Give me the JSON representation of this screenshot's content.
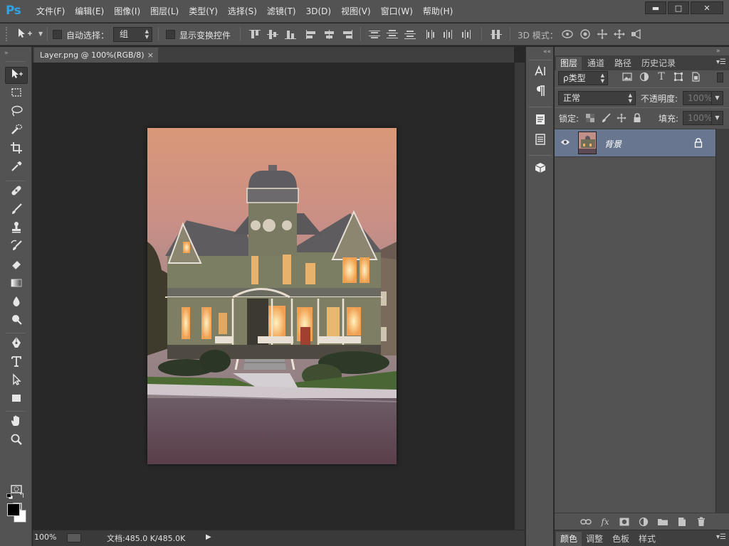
{
  "app": {
    "logo": "Ps"
  },
  "menu": {
    "items": [
      "文件(F)",
      "编辑(E)",
      "图像(I)",
      "图层(L)",
      "类型(Y)",
      "选择(S)",
      "滤镜(T)",
      "3D(D)",
      "视图(V)",
      "窗口(W)",
      "帮助(H)"
    ]
  },
  "window_controls": {
    "minimize": "▬",
    "maximize": "□",
    "close": "✕"
  },
  "options_bar": {
    "auto_select_label": "自动选择：",
    "auto_select_value": "组",
    "show_transform_label": "显示变换控件",
    "mode_3d_label": "3D 模式："
  },
  "document": {
    "tab_title": "Layer.png @ 100%(RGB/8)",
    "tab_close": "×",
    "zoom": "100%",
    "doc_info": "文档:485.0 K/485.0K",
    "status_arrow": "▶"
  },
  "panel": {
    "tabs": [
      "图层",
      "通道",
      "路径",
      "历史记录"
    ],
    "active_tab": "图层",
    "filter_kind": "ρ类型",
    "blend_mode": "正常",
    "opacity_label": "不透明度:",
    "opacity_value": "100%",
    "lock_label": "锁定:",
    "fill_label": "填充:",
    "fill_value": "100%",
    "layers": [
      {
        "name": "背景",
        "visible": true,
        "locked": true,
        "selected": true
      }
    ],
    "footer_fx": "fx"
  },
  "bottom_tabs": [
    "颜色",
    "调整",
    "色板",
    "样式"
  ],
  "colors": {
    "foreground": "#000000",
    "background": "#ffffff",
    "ps_blue": "#2fa3e6",
    "selected_layer": "#68778f"
  },
  "icons": {
    "toolbar": [
      "move-icon",
      "marquee-icon",
      "lasso-icon",
      "quick-select-icon",
      "crop-icon",
      "eyedropper-icon",
      "healing-brush-icon",
      "brush-icon",
      "clone-stamp-icon",
      "history-brush-icon",
      "eraser-icon",
      "gradient-icon",
      "blur-icon",
      "dodge-icon",
      "pen-icon",
      "type-icon",
      "path-select-icon",
      "rectangle-icon",
      "hand-icon",
      "zoom-icon"
    ],
    "dock": [
      "character-icon",
      "paragraph-icon",
      "notes-icon",
      "properties-icon",
      "3d-icon"
    ]
  }
}
